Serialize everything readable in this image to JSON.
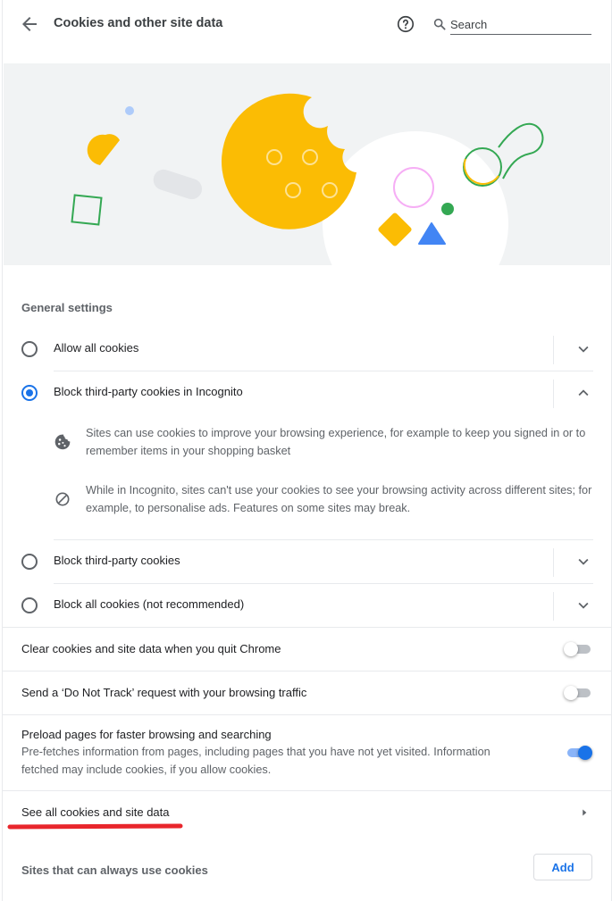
{
  "header": {
    "title": "Cookies and other site data",
    "search_placeholder": "Search"
  },
  "general": {
    "section_title": "General settings",
    "options": [
      {
        "label": "Allow all cookies",
        "selected": false,
        "expanded": false
      },
      {
        "label": "Block third-party cookies in Incognito",
        "selected": true,
        "expanded": true
      },
      {
        "label": "Block third-party cookies",
        "selected": false,
        "expanded": false
      },
      {
        "label": "Block all cookies (not recommended)",
        "selected": false,
        "expanded": false
      }
    ],
    "incognito_details": [
      {
        "icon": "cookie-icon",
        "text": "Sites can use cookies to improve your browsing experience, for example to keep you signed in or to remember items in your shopping basket"
      },
      {
        "icon": "block-icon",
        "text": "While in Incognito, sites can't use your cookies to see your browsing activity across different sites; for example, to personalise ads. Features on some sites may break."
      }
    ]
  },
  "toggles": [
    {
      "label": "Clear cookies and site data when you quit Chrome",
      "on": false
    },
    {
      "label": "Send a ‘Do Not Track’ request with your browsing traffic",
      "on": false
    },
    {
      "label": "Preload pages for faster browsing and searching",
      "description": "Pre-fetches information from pages, including pages that you have not yet visited. Information fetched may include cookies, if you allow cookies.",
      "on": true
    }
  ],
  "see_all": {
    "label": "See all cookies and site data"
  },
  "allow_list": {
    "label": "Sites that can always use cookies",
    "add_label": "Add"
  },
  "colors": {
    "accent": "#1a73e8",
    "cookie": "#fbbc04",
    "green": "#34a853",
    "pink": "#f6aef5",
    "annotation": "#e8262c"
  }
}
